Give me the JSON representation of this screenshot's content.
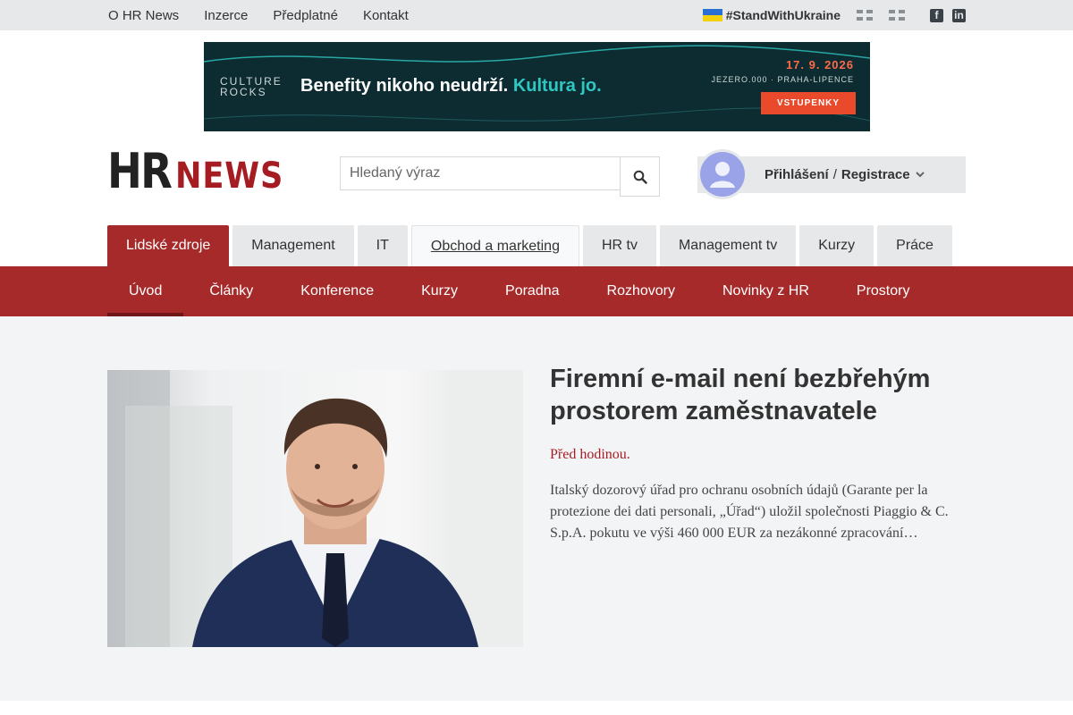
{
  "topnav": {
    "items": [
      "O HR News",
      "Inzerce",
      "Předplatné",
      "Kontakt"
    ],
    "stand_with_ukraine": "#StandWithUkraine",
    "icons": [
      "ukraine-flag-icon",
      "english-flag-icon",
      "english-flag-icon",
      "facebook-icon",
      "linkedin-icon"
    ]
  },
  "banner": {
    "brand_line1": "CULTURE",
    "brand_line2": "ROCKS",
    "headline": "Benefity nikoho neudrží.",
    "headline_accent": "Kultura jo.",
    "date": "17. 9. 2026",
    "venue": "JEZERO.000 · PRAHA-LIPENCE",
    "cta": "VSTUPENKY"
  },
  "logo": {
    "part1": "HR",
    "part2": "NEWS"
  },
  "search": {
    "placeholder": "Hledaný výraz",
    "value": ""
  },
  "account": {
    "login": "Přihlášení",
    "separator": "/",
    "register": "Registrace"
  },
  "tabs": [
    "Lidské zdroje",
    "Management",
    "IT",
    "Obchod a marketing",
    "HR tv",
    "Management tv",
    "Kurzy",
    "Práce"
  ],
  "subnav": [
    "Úvod",
    "Články",
    "Konference",
    "Kurzy",
    "Poradna",
    "Rozhovory",
    "Novinky z HR",
    "Prostory"
  ],
  "article": {
    "title": "Firemní e-mail není bezbřehým prostorem zaměstnavatele",
    "time": "Před hodinou.",
    "lead": "Italský dozorový úřad pro ochranu osobních údajů (Garante per la protezione dei dati personali, „Úřad“) uložil společnosti Piaggio & C. S.p.A. pokutu ve výši 460 000 EUR za nezákonné zpracování…"
  },
  "colors": {
    "brand_red": "#a72a2a",
    "topbar_bg": "#e6e8ea",
    "banner_bg": "#0c2c31",
    "banner_accent": "#2fc7c2",
    "cta_orange": "#e84a2b"
  }
}
